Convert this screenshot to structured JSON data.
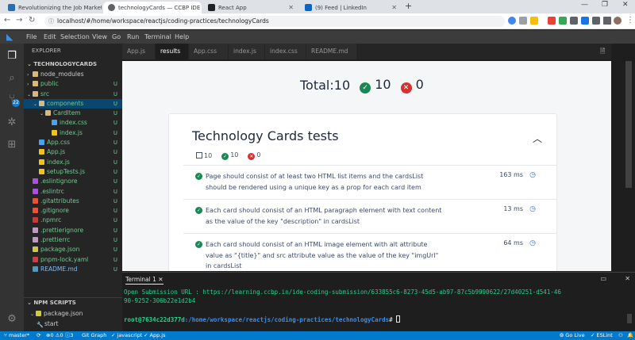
{
  "browser": {
    "tabs": [
      {
        "label": "Revolutionizing the Job Market |",
        "color": "#2b6cb0"
      },
      {
        "label": "technologyCards — CCBP IDE",
        "color": "#5f6368"
      },
      {
        "label": "React App",
        "color": "#202124"
      },
      {
        "label": "(9) Feed | LinkedIn",
        "color": "#0a66c2"
      }
    ],
    "new_tab": "+",
    "url": "localhost/#/home/workspace/reactjs/coding-practices/technologyCards"
  },
  "menu": [
    "File",
    "Edit",
    "Selection",
    "View",
    "Go",
    "Run",
    "Terminal",
    "Help"
  ],
  "activity": {
    "source_control_count": "22"
  },
  "sidebar": {
    "header": "EXPLORER",
    "project": "TECHNOLOGYCARDS",
    "tree": [
      {
        "name": "node_modules",
        "indent": 0,
        "type": "folder",
        "state": "collapsed",
        "status": ""
      },
      {
        "name": "public",
        "indent": 0,
        "type": "folder",
        "state": "collapsed",
        "status": "U"
      },
      {
        "name": "src",
        "indent": 0,
        "type": "folder",
        "state": "expanded",
        "status": "U"
      },
      {
        "name": "components",
        "indent": 1,
        "type": "folder",
        "state": "expanded",
        "status": "U",
        "selected": true
      },
      {
        "name": "CardItem",
        "indent": 2,
        "type": "folder",
        "state": "expanded",
        "status": "U"
      },
      {
        "name": "index.css",
        "indent": 3,
        "type": "css",
        "status": "U"
      },
      {
        "name": "index.js",
        "indent": 3,
        "type": "js",
        "status": "U"
      },
      {
        "name": "App.css",
        "indent": 1,
        "type": "css",
        "status": "U"
      },
      {
        "name": "App.js",
        "indent": 1,
        "type": "js",
        "status": "U"
      },
      {
        "name": "index.js",
        "indent": 1,
        "type": "js",
        "status": "U"
      },
      {
        "name": "setupTests.js",
        "indent": 1,
        "type": "js",
        "status": "U"
      },
      {
        "name": ".eslintignore",
        "indent": 0,
        "type": "eslint",
        "status": "U"
      },
      {
        "name": ".eslintrc",
        "indent": 0,
        "type": "eslint",
        "status": "U"
      },
      {
        "name": ".gitattributes",
        "indent": 0,
        "type": "git",
        "status": "U"
      },
      {
        "name": ".gitignore",
        "indent": 0,
        "type": "git",
        "status": "U"
      },
      {
        "name": ".npmrc",
        "indent": 0,
        "type": "npm",
        "status": "U"
      },
      {
        "name": ".prettierignore",
        "indent": 0,
        "type": "prettier",
        "status": "U"
      },
      {
        "name": ".prettierrc",
        "indent": 0,
        "type": "prettier",
        "status": "U"
      },
      {
        "name": "package.json",
        "indent": 0,
        "type": "json",
        "status": "U"
      },
      {
        "name": "pnpm-lock.yaml",
        "indent": 0,
        "type": "yaml",
        "status": "U"
      },
      {
        "name": "README.md",
        "indent": 0,
        "type": "md",
        "status": "U"
      }
    ],
    "npm_scripts_header": "NPM SCRIPTS",
    "npm_scripts": [
      {
        "name": "package.json",
        "type": "json"
      },
      {
        "name": "start",
        "type": "script"
      }
    ]
  },
  "editor_tabs": [
    "App.js",
    "results",
    "App.css",
    "index.js",
    "index.css",
    "README.md"
  ],
  "active_tab": "results",
  "results": {
    "total_label": "Total:10",
    "passed": "10",
    "failed": "0",
    "card_title": "Technology Cards tests",
    "stats": {
      "total": "10",
      "passed": "10",
      "failed": "0"
    },
    "tests": [
      {
        "desc": "Page should consist of at least two HTML list items and the cardsList should be rendered using a unique key as a prop for each card item",
        "time": "163 ms"
      },
      {
        "desc": "Each card should consist of an HTML paragraph element with text content as the value of the key \"description\" in cardsList",
        "time": "13 ms"
      },
      {
        "desc": "Each card should consist of an HTML image element with alt attribute value as \"{title}\" and src attribute value as the value of the key \"imgUrl\" in cardsList",
        "time": "64 ms"
      }
    ]
  },
  "terminal": {
    "tab": "Terminal 1",
    "line1": "Open Submission URL : https://learning.ccbp.in/ide-coding-submission/633855c6-8273-45d5-ab97-87c5b9990622/27d40251-d541-46",
    "line2": "90-9252-306b22e1d2b4",
    "prompt_user": "root@7634c22d377d",
    "prompt_path": ":/home/workspace/reactjs/coding-practices/technologyCards",
    "prompt_end": "#"
  },
  "statusbar": {
    "branch": "master*",
    "problems": "0",
    "warnings": "0",
    "info": "3",
    "git_graph": "Git Graph",
    "language": "javascript",
    "file": "App.js",
    "go_live": "Go Live",
    "eslint": "ESLint"
  }
}
